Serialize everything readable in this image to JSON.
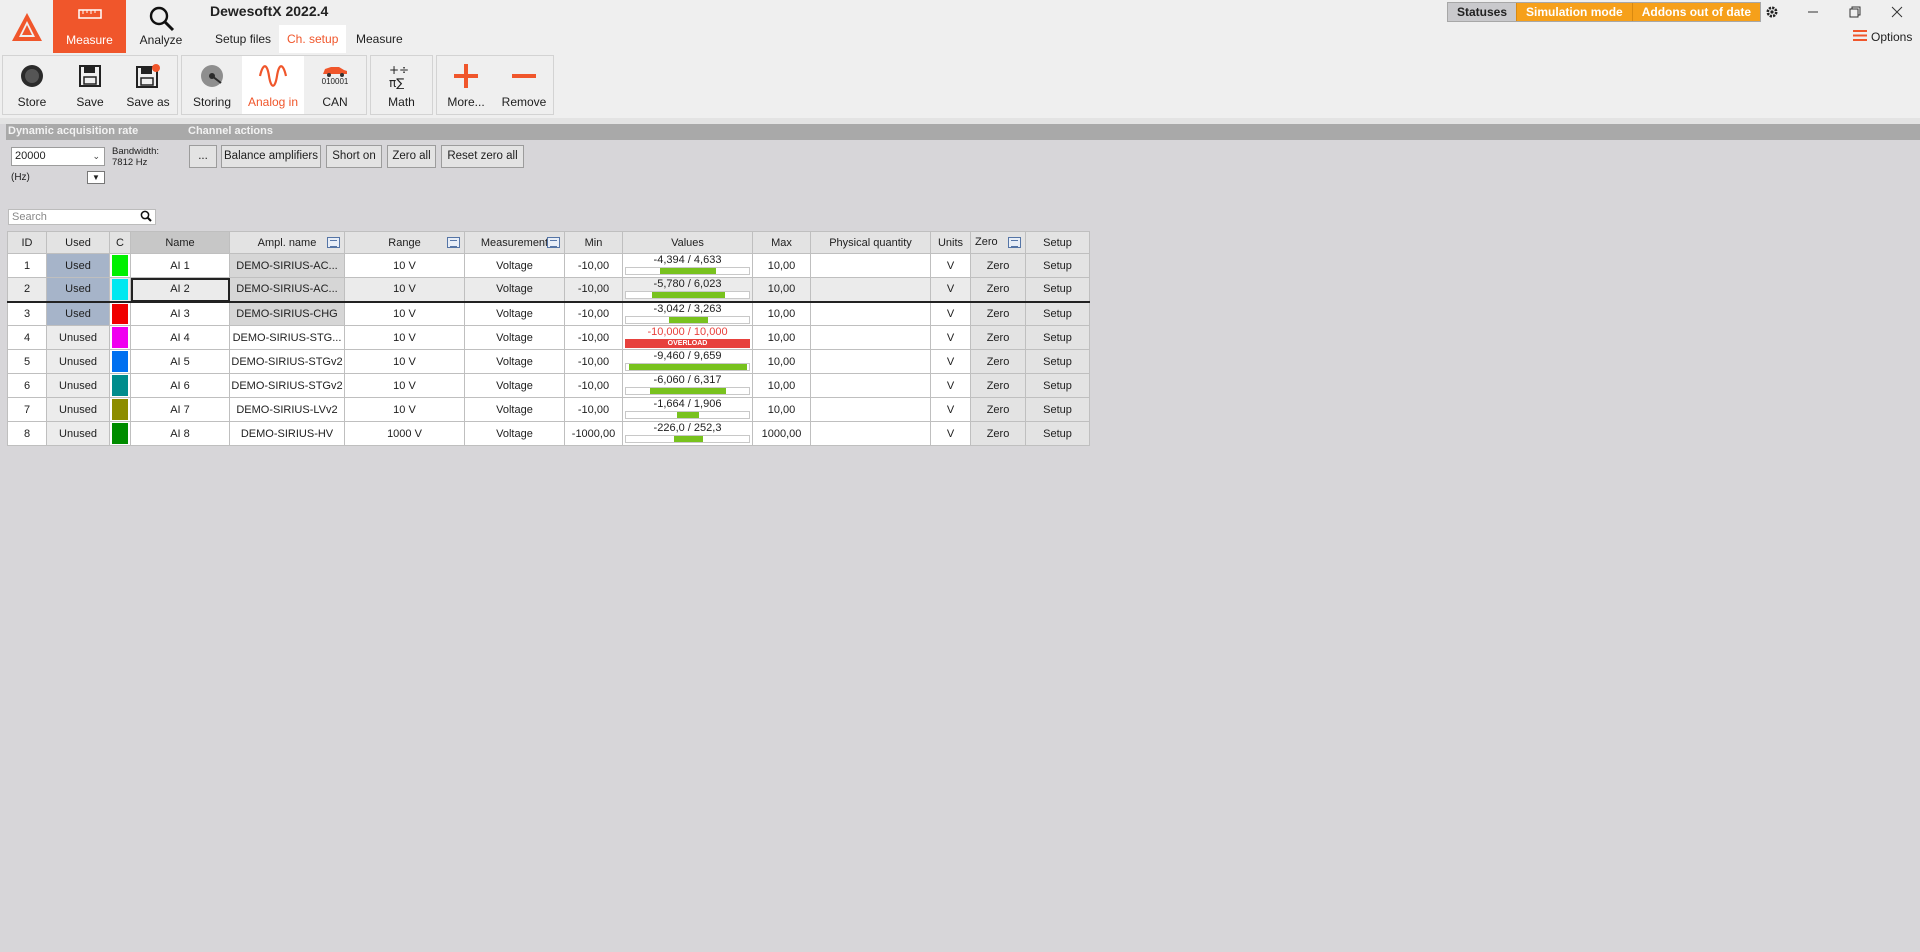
{
  "app": {
    "title": "DewesoftX 2022.4",
    "main_tabs": [
      {
        "label": "Measure",
        "icon": "ruler-icon",
        "active": true
      },
      {
        "label": "Analyze",
        "icon": "magnifier-icon",
        "active": false
      }
    ],
    "sub_tabs": [
      {
        "label": "Setup files",
        "active": false
      },
      {
        "label": "Ch. setup",
        "active": true
      },
      {
        "label": "Measure",
        "active": false
      }
    ],
    "statuses": {
      "statuses": "Statuses",
      "simulation": "Simulation mode",
      "addons": "Addons out of date"
    },
    "options_label": "Options",
    "accent_color": "#f0562b"
  },
  "toolbar": {
    "groups": [
      [
        {
          "label": "Store",
          "icon": "store-record-icon"
        },
        {
          "label": "Save",
          "icon": "floppy-icon"
        },
        {
          "label": "Save as",
          "icon": "floppy-edit-icon"
        }
      ],
      [
        {
          "label": "Storing",
          "icon": "disk-storing-icon"
        },
        {
          "label": "Analog in",
          "icon": "sine-wave-icon",
          "active": true
        },
        {
          "label": "CAN",
          "icon": "car-can-icon",
          "sublabel": "010001"
        }
      ],
      [
        {
          "label": "Math",
          "icon": "math-symbols-icon"
        }
      ],
      [
        {
          "label": "More...",
          "icon": "plus-icon"
        },
        {
          "label": "Remove",
          "icon": "minus-icon"
        }
      ]
    ]
  },
  "acquisition": {
    "header": "Dynamic acquisition rate",
    "rate": "20000",
    "unit": "(Hz)",
    "bandwidth_label": "Bandwidth:",
    "bandwidth_value": "7812 Hz"
  },
  "channel_actions": {
    "header": "Channel actions",
    "buttons": [
      "...",
      "Balance amplifiers",
      "Short on",
      "Zero all",
      "Reset zero all"
    ]
  },
  "search": {
    "placeholder": "Search"
  },
  "table": {
    "columns": [
      "ID",
      "Used",
      "C",
      "Name",
      "Ampl. name",
      "Range",
      "Measurement",
      "Min",
      "Values",
      "Max",
      "Physical quantity",
      "Units",
      "Zero",
      "Setup"
    ],
    "rows": [
      {
        "id": "1",
        "used": "Used",
        "color": "#00f000",
        "name": "AI 1",
        "ampl": "DEMO-SIRIUS-AC...",
        "range": "10 V",
        "measurement": "Voltage",
        "min": "-10,00",
        "values": "-4,394 / 4,633",
        "bar_from": -4.394,
        "bar_to": 4.633,
        "overload": false,
        "max": "10,00",
        "physical": "",
        "units": "V",
        "zero": "Zero",
        "setup": "Setup"
      },
      {
        "id": "2",
        "used": "Used",
        "color": "#00e8f0",
        "name": "AI 2",
        "ampl": "DEMO-SIRIUS-AC...",
        "range": "10 V",
        "measurement": "Voltage",
        "min": "-10,00",
        "values": "-5,780 / 6,023",
        "bar_from": -5.78,
        "bar_to": 6.023,
        "overload": false,
        "max": "10,00",
        "physical": "",
        "units": "V",
        "zero": "Zero",
        "setup": "Setup",
        "selected": true
      },
      {
        "id": "3",
        "used": "Used",
        "color": "#f00000",
        "name": "AI 3",
        "ampl": "DEMO-SIRIUS-CHG",
        "range": "10 V",
        "measurement": "Voltage",
        "min": "-10,00",
        "values": "-3,042 / 3,263",
        "bar_from": -3.042,
        "bar_to": 3.263,
        "overload": false,
        "max": "10,00",
        "physical": "",
        "units": "V",
        "zero": "Zero",
        "setup": "Setup"
      },
      {
        "id": "4",
        "used": "Unused",
        "color": "#f000f0",
        "name": "AI 4",
        "ampl": "DEMO-SIRIUS-STG...",
        "range": "10 V",
        "measurement": "Voltage",
        "min": "-10,00",
        "values": "-10,000 / 10,000",
        "bar_from": -10,
        "bar_to": 10,
        "overload": true,
        "overload_label": "OVERLOAD",
        "max": "10,00",
        "physical": "",
        "units": "V",
        "zero": "Zero",
        "setup": "Setup"
      },
      {
        "id": "5",
        "used": "Unused",
        "color": "#0070f0",
        "name": "AI 5",
        "ampl": "DEMO-SIRIUS-STGv2",
        "range": "10 V",
        "measurement": "Voltage",
        "min": "-10,00",
        "values": "-9,460 / 9,659",
        "bar_from": -9.46,
        "bar_to": 9.659,
        "overload": false,
        "max": "10,00",
        "physical": "",
        "units": "V",
        "zero": "Zero",
        "setup": "Setup"
      },
      {
        "id": "6",
        "used": "Unused",
        "color": "#008c8c",
        "name": "AI 6",
        "ampl": "DEMO-SIRIUS-STGv2",
        "range": "10 V",
        "measurement": "Voltage",
        "min": "-10,00",
        "values": "-6,060 / 6,317",
        "bar_from": -6.06,
        "bar_to": 6.317,
        "overload": false,
        "max": "10,00",
        "physical": "",
        "units": "V",
        "zero": "Zero",
        "setup": "Setup"
      },
      {
        "id": "7",
        "used": "Unused",
        "color": "#8c8c00",
        "name": "AI 7",
        "ampl": "DEMO-SIRIUS-LVv2",
        "range": "10 V",
        "measurement": "Voltage",
        "min": "-10,00",
        "values": "-1,664 / 1,906",
        "bar_from": -1.664,
        "bar_to": 1.906,
        "overload": false,
        "max": "10,00",
        "physical": "",
        "units": "V",
        "zero": "Zero",
        "setup": "Setup"
      },
      {
        "id": "8",
        "used": "Unused",
        "color": "#008c00",
        "name": "AI 8",
        "ampl": "DEMO-SIRIUS-HV",
        "range": "1000 V",
        "measurement": "Voltage",
        "min": "-1000,00",
        "values": "-226,0 / 252,3",
        "bar_from": -226,
        "bar_to": 252.3,
        "overload": false,
        "max": "1000,00",
        "physical": "",
        "units": "V",
        "zero": "Zero",
        "setup": "Setup"
      }
    ]
  }
}
